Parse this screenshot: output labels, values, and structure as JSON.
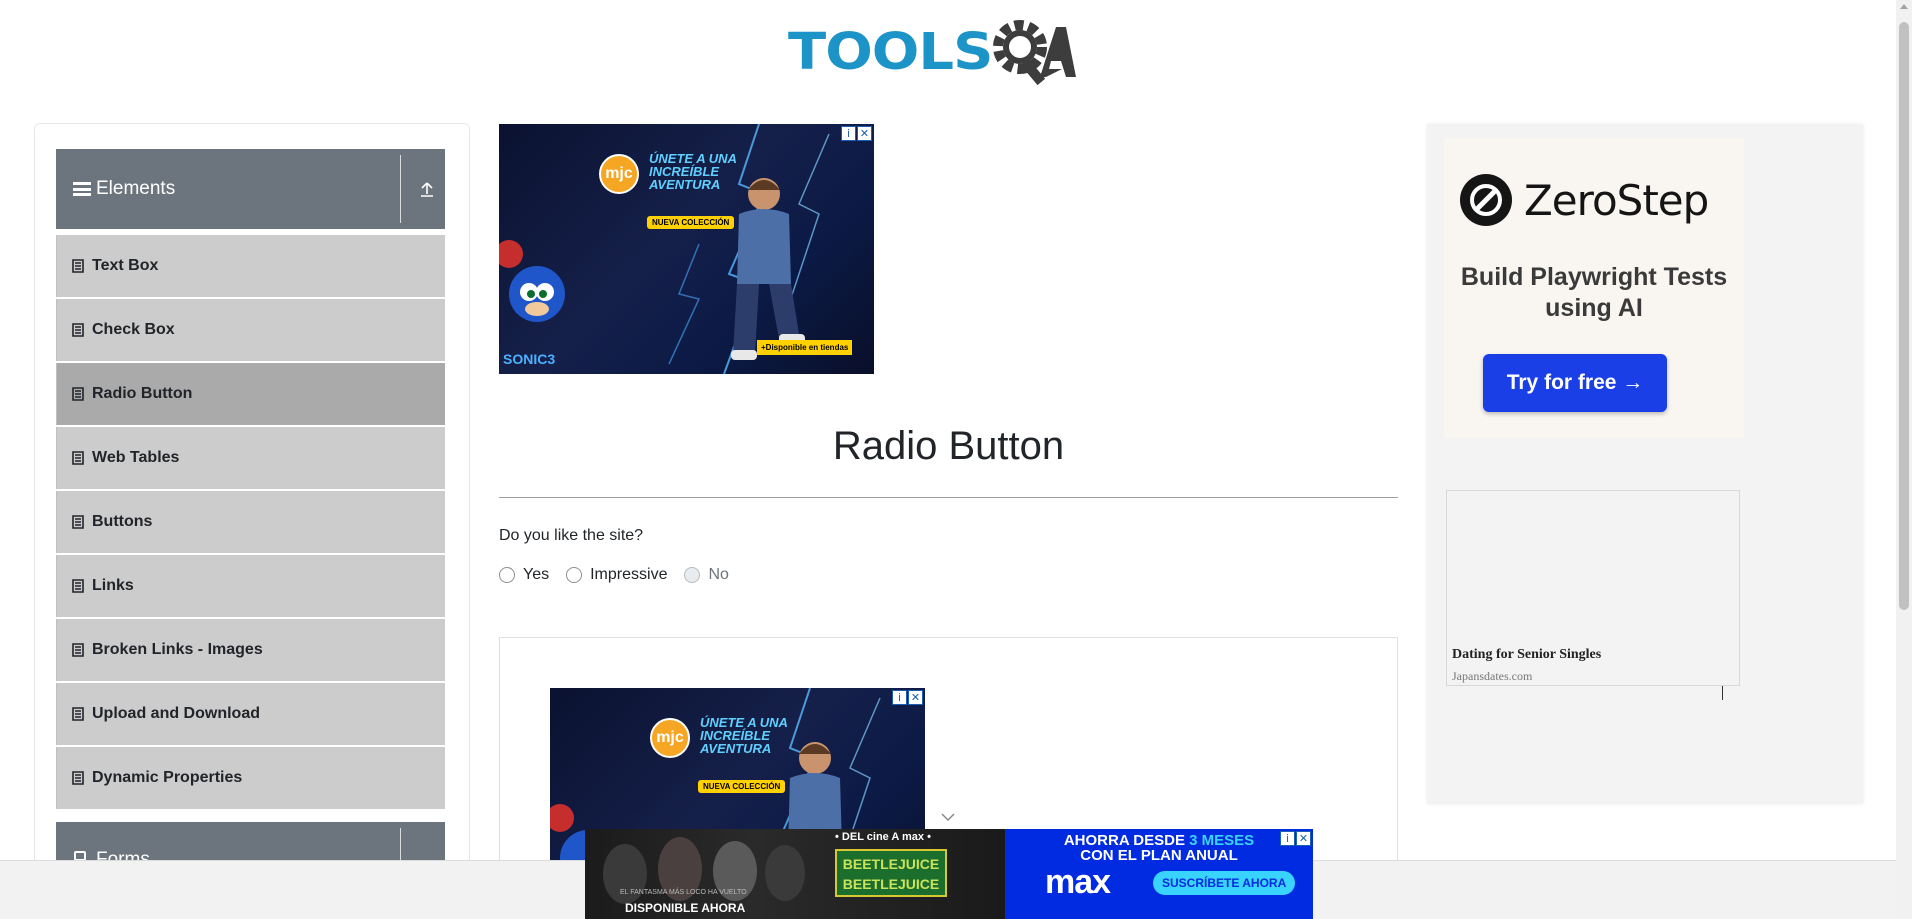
{
  "logo": {
    "text": "TOOLSQA",
    "left": "TOOLS",
    "right": "A"
  },
  "sidebar": {
    "group_title": "Elements",
    "items": [
      {
        "label": "Text Box",
        "active": false
      },
      {
        "label": "Check Box",
        "active": false
      },
      {
        "label": "Radio Button",
        "active": true
      },
      {
        "label": "Web Tables",
        "active": false
      },
      {
        "label": "Buttons",
        "active": false
      },
      {
        "label": "Links",
        "active": false
      },
      {
        "label": "Broken Links - Images",
        "active": false
      },
      {
        "label": "Upload and Download",
        "active": false
      },
      {
        "label": "Dynamic Properties",
        "active": false
      }
    ],
    "next_group_title": "Forms"
  },
  "main": {
    "title": "Radio Button",
    "question": "Do you like the site?",
    "options": [
      {
        "label": "Yes",
        "disabled": false
      },
      {
        "label": "Impressive",
        "disabled": false
      },
      {
        "label": "No",
        "disabled": true
      }
    ]
  },
  "ads": {
    "top": {
      "brand": "mjc",
      "headline": "ÚNETE A UNA INCREÍBLE AVENTURA",
      "badge": "NUEVA COLECCIÓN",
      "availability": "+Disponible en tiendas",
      "movie": "SONIC3"
    },
    "zerostep": {
      "name": "ZeroStep",
      "tagline": "Build Playwright Tests using AI",
      "button": "Try for free →"
    },
    "dating": {
      "title": "Dating for Senior Singles",
      "site": "Japansdates.com"
    },
    "bottom": {
      "cine": "• DEL cine A max •",
      "movie": "BEETLEJUICE BEETLEJUICE",
      "tagline": "EL FANTASMA MÁS LOCO HA VUELTO",
      "available": "DISPONIBLE AHORA",
      "promo_line1": "AHORRA DESDE",
      "promo_highlight": "3 MESES",
      "promo_line2": "CON EL PLAN ANUAL",
      "brand": "max",
      "cta": "SUSCRÍBETE AHORA"
    }
  },
  "colors": {
    "logo_blue": "#1d94c7",
    "logo_dark": "#3d3d3d",
    "sidebar_header": "#6c757d",
    "menu_item": "#cccccc",
    "menu_item_active": "#aaaaaa",
    "zerostep_button": "#1a3fe6"
  }
}
